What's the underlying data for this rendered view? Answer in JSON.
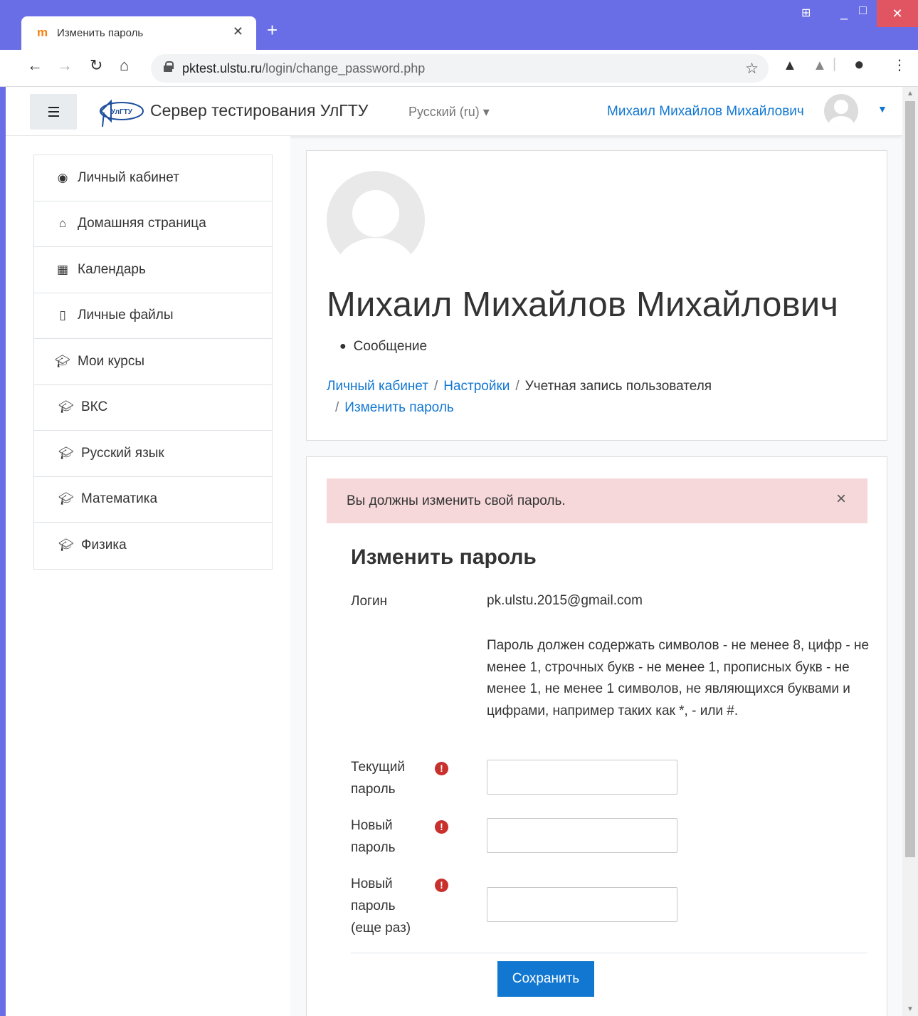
{
  "browser": {
    "tab_title": "Изменить пароль",
    "tab_favicon": "m",
    "url_host": "pktest.ulstu.ru",
    "url_path": "/login/change_password.php"
  },
  "navbar": {
    "logo_text": "УлГТУ",
    "site_name": "Сервер тестирования УлГТУ",
    "language": "Русский (ru) ▾",
    "user_name": "Михаил Михайлов Михайлович"
  },
  "sidebar": {
    "items": [
      {
        "label": "Личный кабинет",
        "icon": "dashboard-icon"
      },
      {
        "label": "Домашняя страница",
        "icon": "home-icon"
      },
      {
        "label": "Календарь",
        "icon": "calendar-icon"
      },
      {
        "label": "Личные файлы",
        "icon": "file-icon"
      },
      {
        "label": "Мои курсы",
        "icon": "graduation-cap-icon"
      },
      {
        "label": "ВКС",
        "icon": "graduation-cap-icon"
      },
      {
        "label": "Русский язык",
        "icon": "graduation-cap-icon"
      },
      {
        "label": "Математика",
        "icon": "graduation-cap-icon"
      },
      {
        "label": "Физика",
        "icon": "graduation-cap-icon"
      }
    ]
  },
  "profile": {
    "full_name": "Михаил Михайлов Михайлович",
    "message_label": "Сообщение"
  },
  "breadcrumb": {
    "items": [
      "Личный кабинет",
      "Настройки",
      "Учетная запись пользователя",
      "Изменить пароль"
    ],
    "separator": "/"
  },
  "alert": {
    "text": "Вы должны изменить свой пароль.",
    "close": "×"
  },
  "form": {
    "title": "Изменить пароль",
    "login_label": "Логин",
    "login_value": "pk.ulstu.2015@gmail.com",
    "hint": "Пароль должен содержать символов - не менее 8, цифр - не менее 1, строчных букв - не менее 1, прописных букв - не менее 1, не менее 1 символов, не являющихся буквами и цифрами, например таких как *, - или #.",
    "current_password_label": "Текущий пароль",
    "new_password_label": "Новый пароль",
    "new_password_again_label": "Новый пароль (еще раз)",
    "required_marker": "!",
    "save_label": "Сохранить"
  }
}
